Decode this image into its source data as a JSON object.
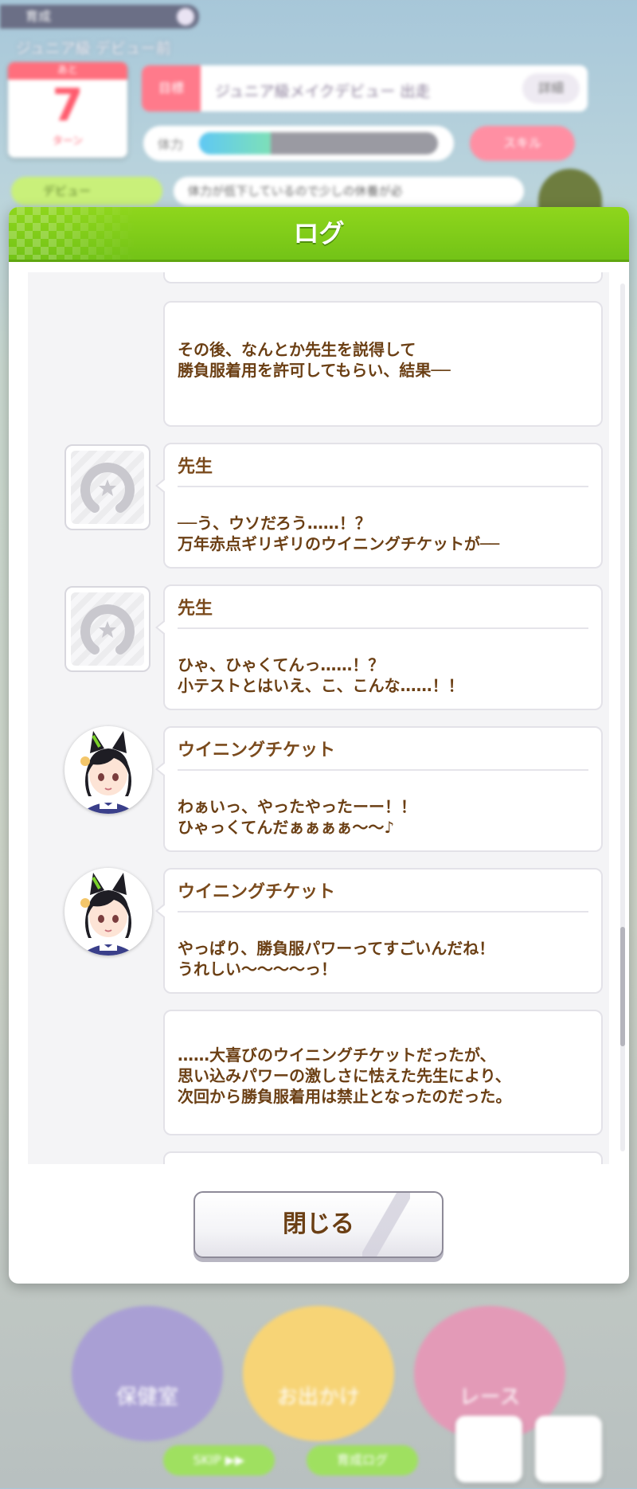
{
  "background": {
    "topbar_label": "育成",
    "class_label": "ジュニア級 デビュー前",
    "calendar": {
      "header": "あと",
      "number": "7",
      "unit": "ターン"
    },
    "goal": {
      "tag": "目標",
      "text": "ジュニア級メイクデビュー 出走",
      "button": "詳細"
    },
    "energy": {
      "label": "体力",
      "level": 0.3
    },
    "skill_button": "スキル",
    "debut_badge": "デビュー",
    "hint_text": "体力が低下しているので少しの休養が必",
    "menu_buttons": [
      "保健室",
      "お出かけ",
      "レース"
    ],
    "small_buttons": [
      "SKIP ▶▶",
      "育成ログ"
    ]
  },
  "dialog": {
    "title": "ログ",
    "close_label": "閉じる",
    "scroll_position": 0.86
  },
  "log_entries": [
    {
      "speaker": "",
      "text": "その後、なんとか先生を説得して\n勝負服着用を許可してもらい、結果──",
      "avatar": "none"
    },
    {
      "speaker": "先生",
      "text": "──う、ウソだろう……！？\n万年赤点ギリギリのウイニングチケットが──",
      "avatar": "placeholder"
    },
    {
      "speaker": "先生",
      "text": "ひゃ、ひゃくてんっ……！？\n小テストとはいえ、こ、こんな……！！",
      "avatar": "placeholder"
    },
    {
      "speaker": "ウイニングチケット",
      "text": "わぁいっ、やったやったーー！！\nひゃっくてんだぁぁぁぁ～～♪",
      "avatar": "winning-ticket"
    },
    {
      "speaker": "ウイニングチケット",
      "text": "やっぱり、勝負服パワーってすごいんだね！\nうれしい～～～～っ！",
      "avatar": "winning-ticket"
    },
    {
      "speaker": "",
      "text": "……大喜びのウイニングチケットだったが、\n思い込みパワーの激しさに怯えた先生により、\n次回から勝負服着用は禁止となったのだった。",
      "avatar": "none"
    }
  ],
  "colors": {
    "header_green": "#7ccb18",
    "text_brown": "#6b3f14"
  }
}
